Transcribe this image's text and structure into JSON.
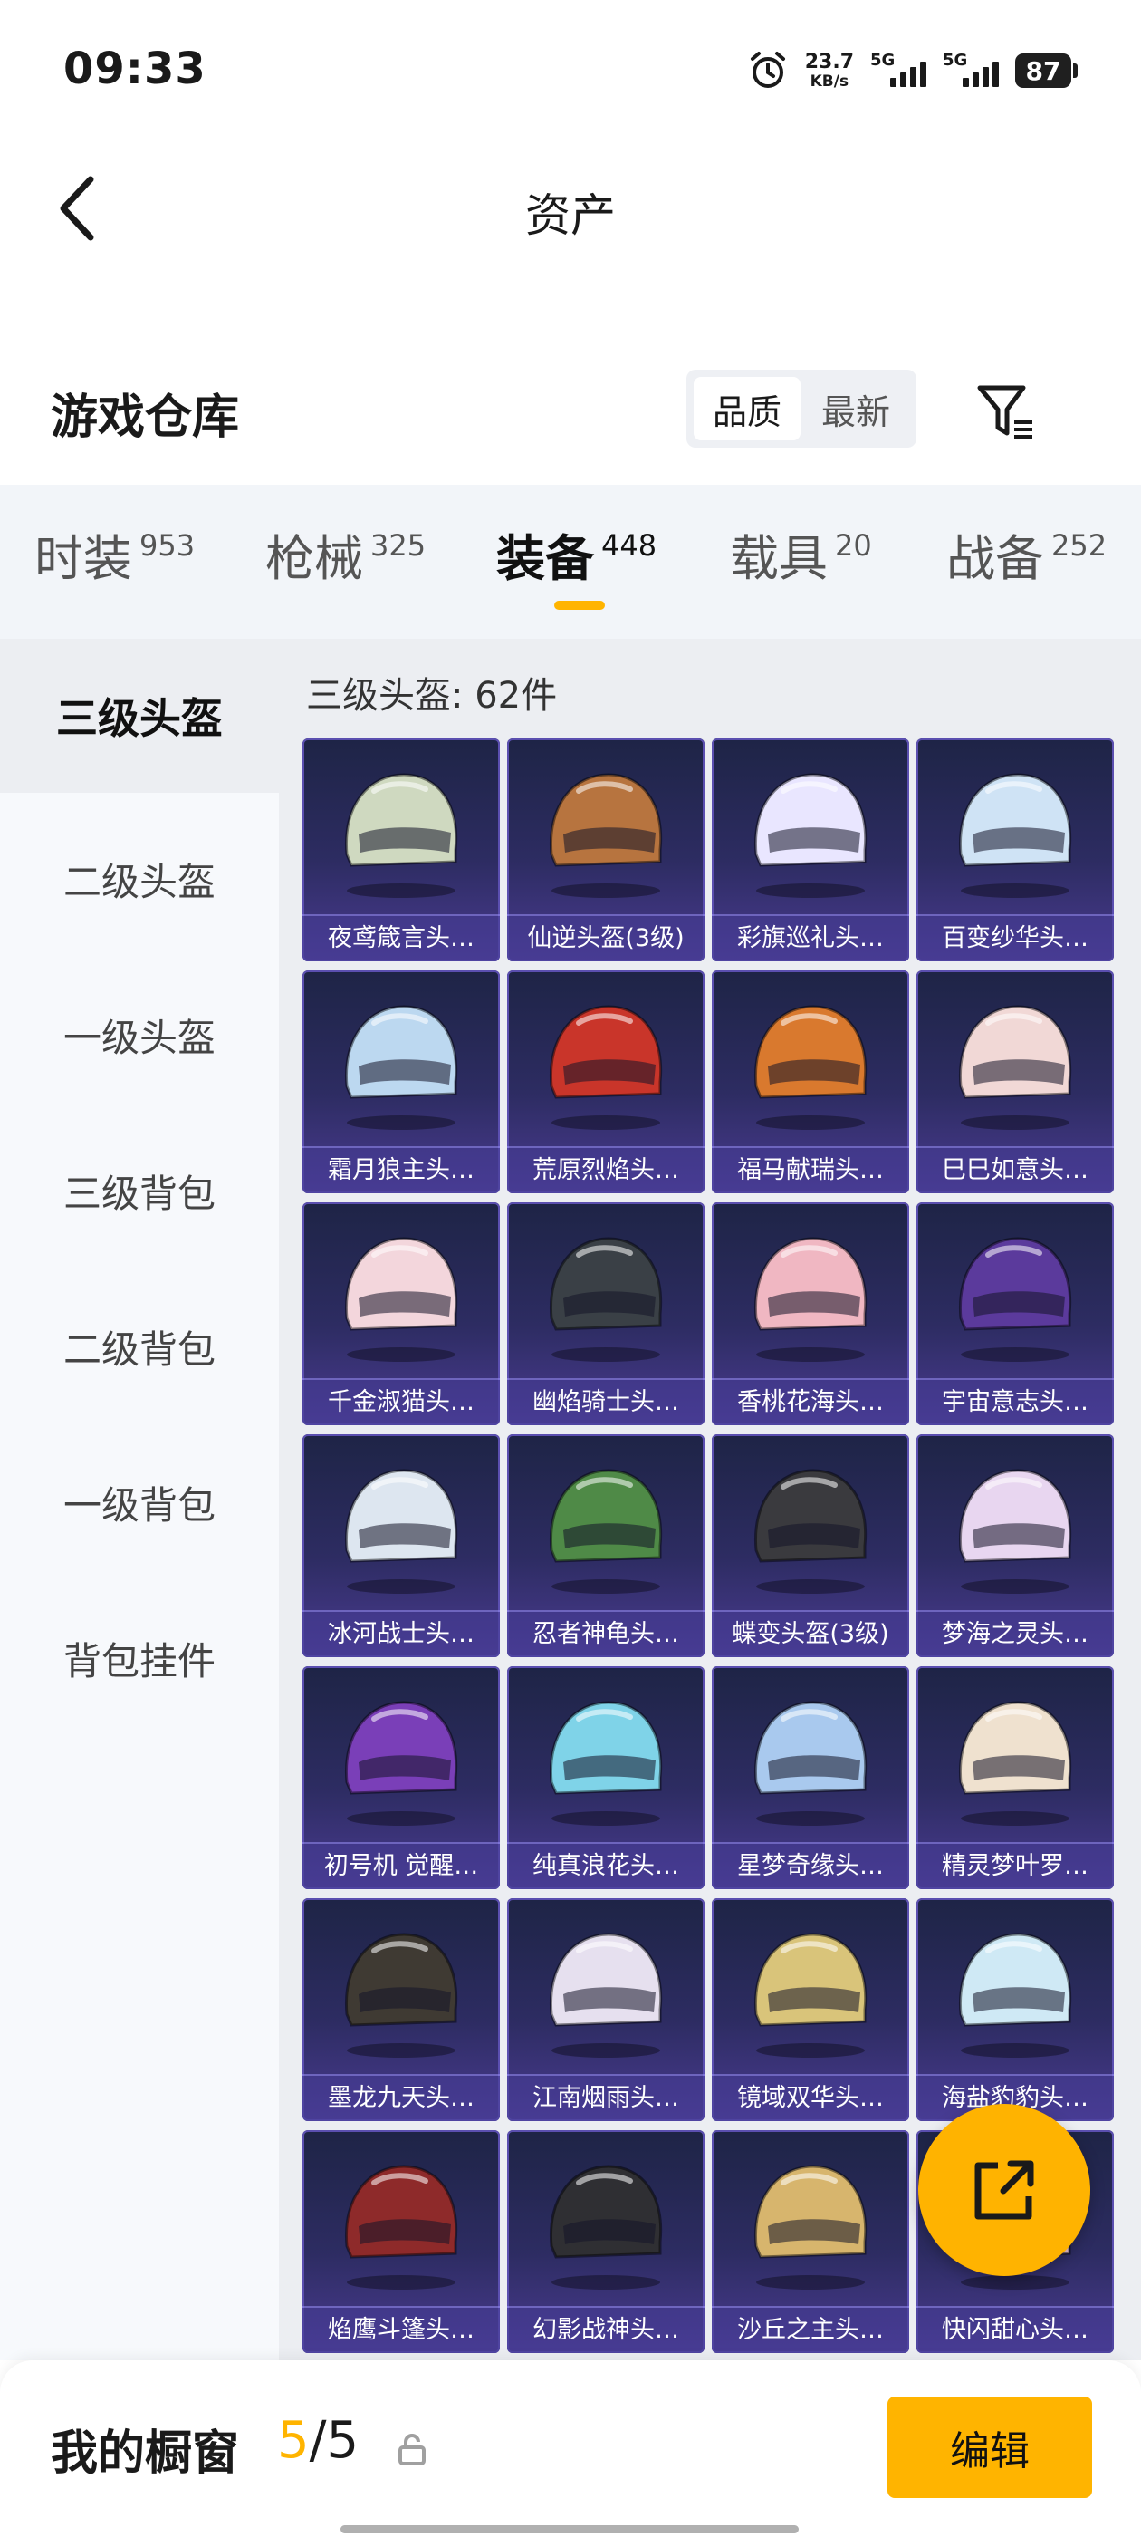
{
  "status": {
    "time": "09:33",
    "net_speed_value": "23.7",
    "net_speed_unit": "KB/s",
    "sim1": "5G",
    "sim2": "5G",
    "battery": "87"
  },
  "nav": {
    "title": "资产"
  },
  "warehouse": {
    "title": "游戏仓库",
    "sort_options": [
      "品质",
      "最新"
    ],
    "sort_active": "品质"
  },
  "tabs": [
    {
      "label": "时装",
      "count": "953"
    },
    {
      "label": "枪械",
      "count": "325"
    },
    {
      "label": "装备",
      "count": "448",
      "active": true
    },
    {
      "label": "载具",
      "count": "20"
    },
    {
      "label": "战备",
      "count": "252"
    }
  ],
  "sidebar": [
    "三级头盔",
    "二级头盔",
    "一级头盔",
    "三级背包",
    "二级背包",
    "一级背包",
    "背包挂件"
  ],
  "section_title": "三级头盔: 62件",
  "items": [
    {
      "name": "夜鸢箴言头…",
      "color": "#cfd9c0"
    },
    {
      "name": "仙逆头盔(3级)",
      "color": "#b7743f"
    },
    {
      "name": "彩旗巡礼头…",
      "color": "#e9e6ff"
    },
    {
      "name": "百变纱华头…",
      "color": "#cfe3f5"
    },
    {
      "name": "霜月狼主头…",
      "color": "#bcd8f0"
    },
    {
      "name": "荒原烈焰头…",
      "color": "#c9352a"
    },
    {
      "name": "福马献瑞头…",
      "color": "#d9792e"
    },
    {
      "name": "巳巳如意头…",
      "color": "#f1d8d6"
    },
    {
      "name": "千金淑猫头…",
      "color": "#f3d6dc"
    },
    {
      "name": "幽焰骑士头…",
      "color": "#3a4046"
    },
    {
      "name": "香桃花海头…",
      "color": "#f0b7c2"
    },
    {
      "name": "宇宙意志头…",
      "color": "#5b3a9c"
    },
    {
      "name": "冰河战士头…",
      "color": "#dde6f0"
    },
    {
      "name": "忍者神龟头…",
      "color": "#4f8a47"
    },
    {
      "name": "蝶变头盔(3级)",
      "color": "#3a3a3e"
    },
    {
      "name": "梦海之灵头…",
      "color": "#e8d6f0"
    },
    {
      "name": "初号机 觉醒…",
      "color": "#7a3fb8"
    },
    {
      "name": "纯真浪花头…",
      "color": "#7fd3e8"
    },
    {
      "name": "星梦奇缘头…",
      "color": "#a9c9ee"
    },
    {
      "name": "精灵梦叶罗…",
      "color": "#efe1cf"
    },
    {
      "name": "墨龙九天头…",
      "color": "#3f3a33"
    },
    {
      "name": "江南烟雨头…",
      "color": "#e6e0ef"
    },
    {
      "name": "镜域双华头…",
      "color": "#d9c47a"
    },
    {
      "name": "海盐豹豹头…",
      "color": "#cfe9f5"
    },
    {
      "name": "焰鹰斗篷头…",
      "color": "#8e2a2a"
    },
    {
      "name": "幻影战神头…",
      "color": "#2f2f33"
    },
    {
      "name": "沙丘之主头…",
      "color": "#d7b56d"
    },
    {
      "name": "快闪甜心头…",
      "color": "#f1c7d6"
    }
  ],
  "showcase": {
    "label": "我的橱窗",
    "current": "5",
    "total": "/5"
  },
  "edit_label": "编辑",
  "colors": {
    "accent": "#ffb400",
    "card_bg": "#2d2c62"
  }
}
